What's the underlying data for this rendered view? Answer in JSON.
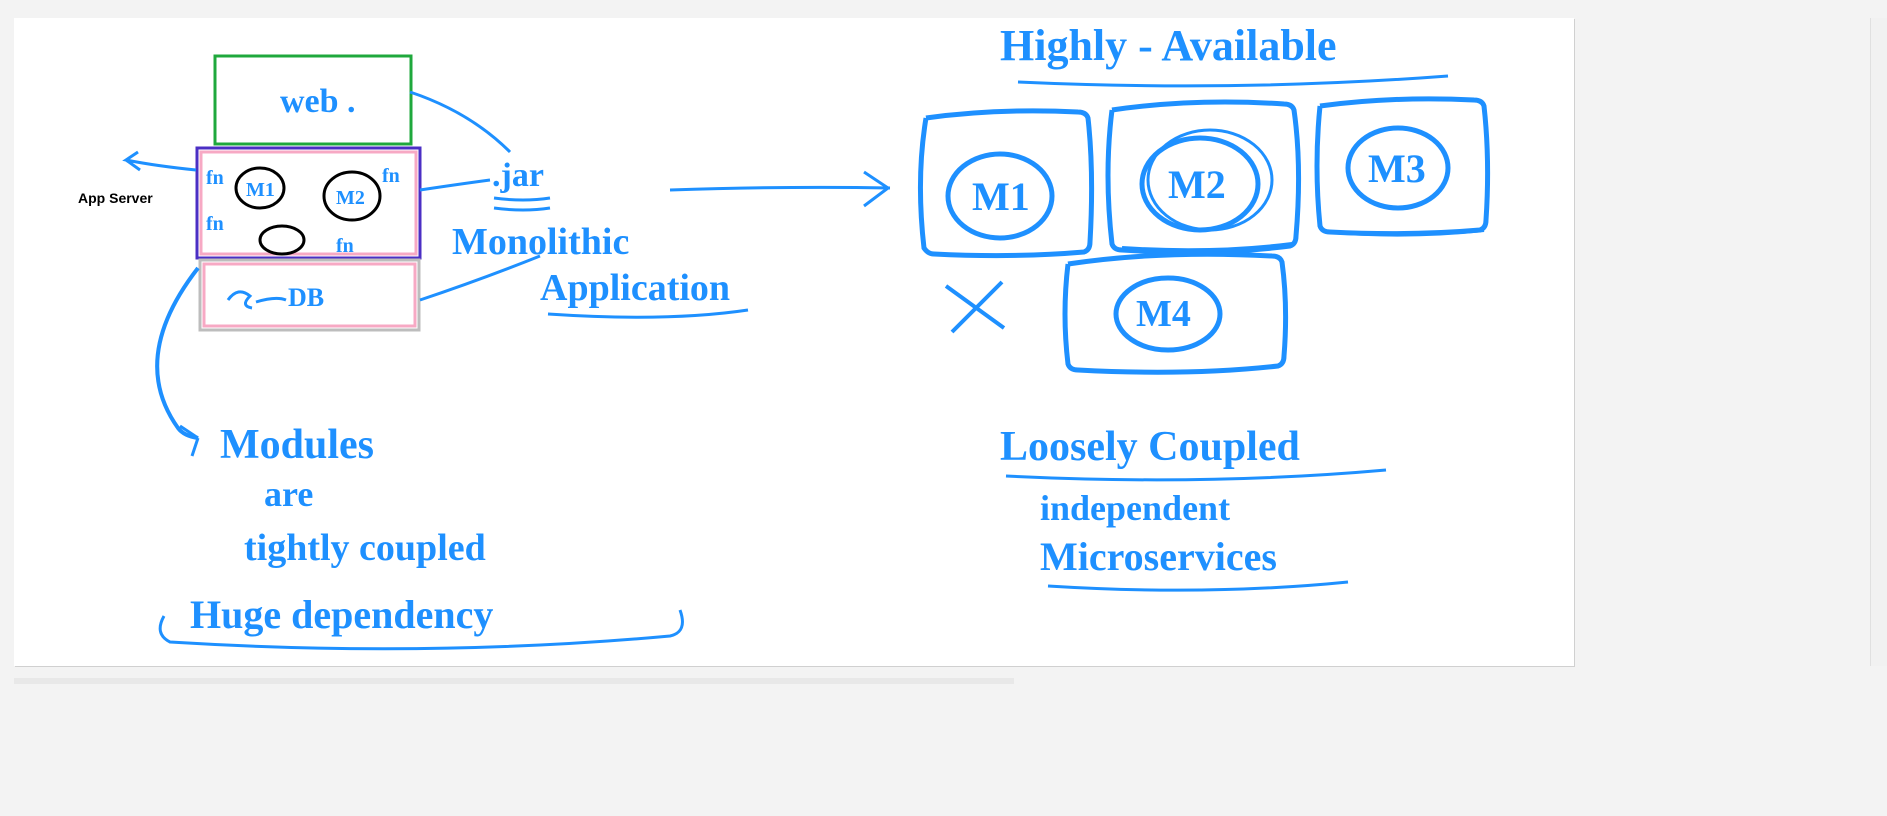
{
  "typed": {
    "app_server": "App Server"
  },
  "handwriting": {
    "web": "web .",
    "jar": ".jar",
    "monolithic": "Monolithic",
    "application": "Application",
    "db": "DB",
    "fn": "fn",
    "fn2": "fn",
    "fn3": "fn",
    "fn4": "fn",
    "m1s": "M1",
    "m2s": "M2",
    "modules": "Modules",
    "are": "are",
    "tightly": "tightly coupled",
    "huge": "Huge  dependency",
    "highly": "Highly - Available",
    "m1": "M1",
    "m2": "M2",
    "m3": "M3",
    "m4": "M4",
    "loosely": "Loosely Coupled",
    "independent": "independent",
    "micro": "Microservices"
  },
  "colors": {
    "ink": "#1e90ff",
    "green": "#1fa83c",
    "purple": "#4b2fc4",
    "pink": "#f7a9c4",
    "grey": "#bdbdbd",
    "black": "#000000"
  }
}
